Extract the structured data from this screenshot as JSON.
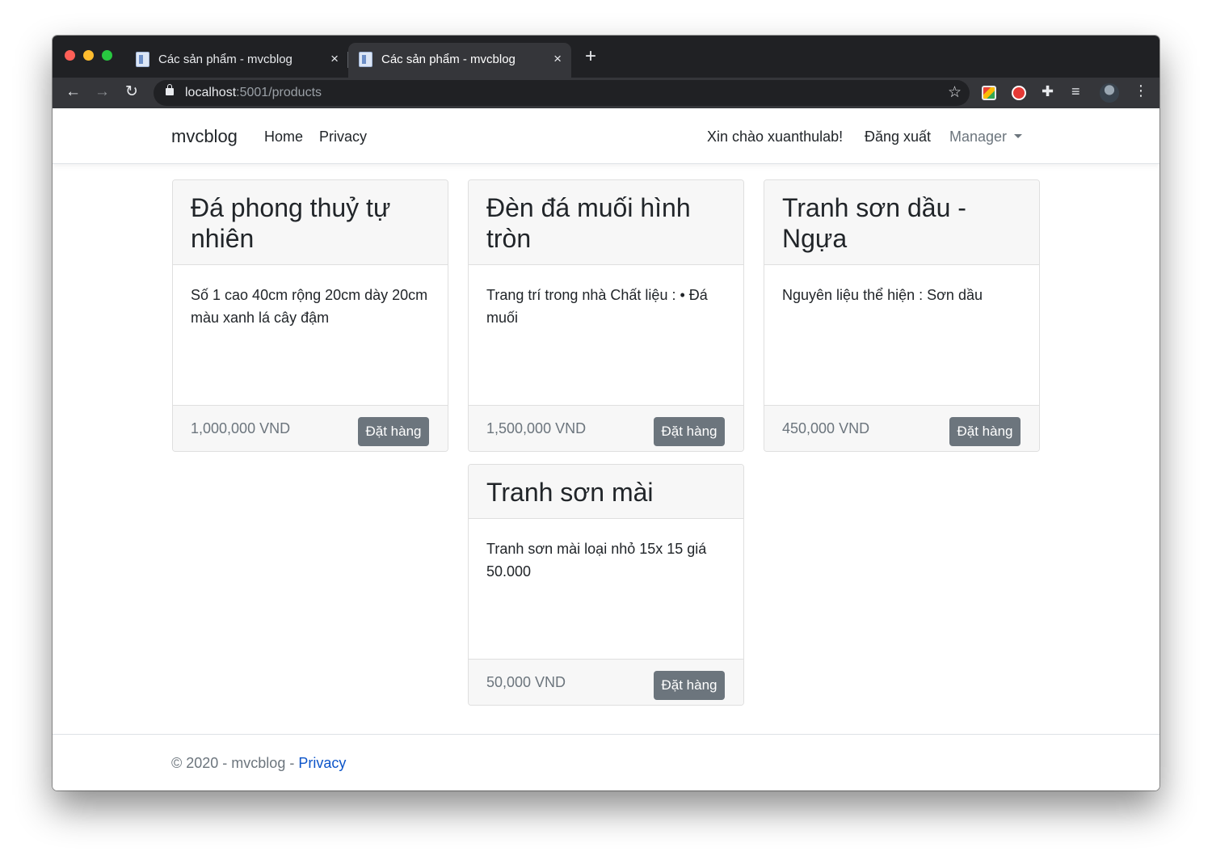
{
  "browser": {
    "tabs": [
      {
        "title": "Các sản phẩm - mvcblog",
        "close": "×"
      },
      {
        "title": "Các sản phẩm - mvcblog",
        "close": "×"
      }
    ],
    "new_tab": "+",
    "url_host": "localhost",
    "url_rest": ":5001/products",
    "icons": {
      "back": "←",
      "forward": "→",
      "reload": "↻",
      "star": "☆",
      "puzzle": "✚",
      "media": "≡",
      "menu": "⋮"
    }
  },
  "navbar": {
    "brand": "mvcblog",
    "links": [
      "Home",
      "Privacy"
    ],
    "greeting": "Xin chào xuanthulab!",
    "logout": "Đăng xuất",
    "manager": "Manager"
  },
  "products": [
    {
      "title": "Đá phong thuỷ tự nhiên",
      "description": "Số 1 cao 40cm rộng 20cm dày 20cm màu xanh lá cây đậm",
      "price": "1,000,000 VND",
      "button": "Đặt hàng"
    },
    {
      "title": "Đèn đá muối hình tròn",
      "description": "Trang trí trong nhà Chất liệu : • Đá muối",
      "price": "1,500,000 VND",
      "button": "Đặt hàng"
    },
    {
      "title": "Tranh sơn dầu - Ngựa",
      "description": "Nguyên liệu thể hiện : Sơn dầu",
      "price": "450,000 VND",
      "button": "Đặt hàng"
    },
    {
      "title": "Tranh sơn mài",
      "description": "Tranh sơn mài loại nhỏ 15x 15 giá 50.000",
      "price": "50,000 VND",
      "button": "Đặt hàng"
    }
  ],
  "footer": {
    "text": "© 2020 - mvcblog - ",
    "link": "Privacy"
  },
  "colors": {
    "button": "#6c757d",
    "link": "#0d55c9",
    "chrome_dark": "#202124",
    "chrome_toolbar": "#35363a"
  }
}
